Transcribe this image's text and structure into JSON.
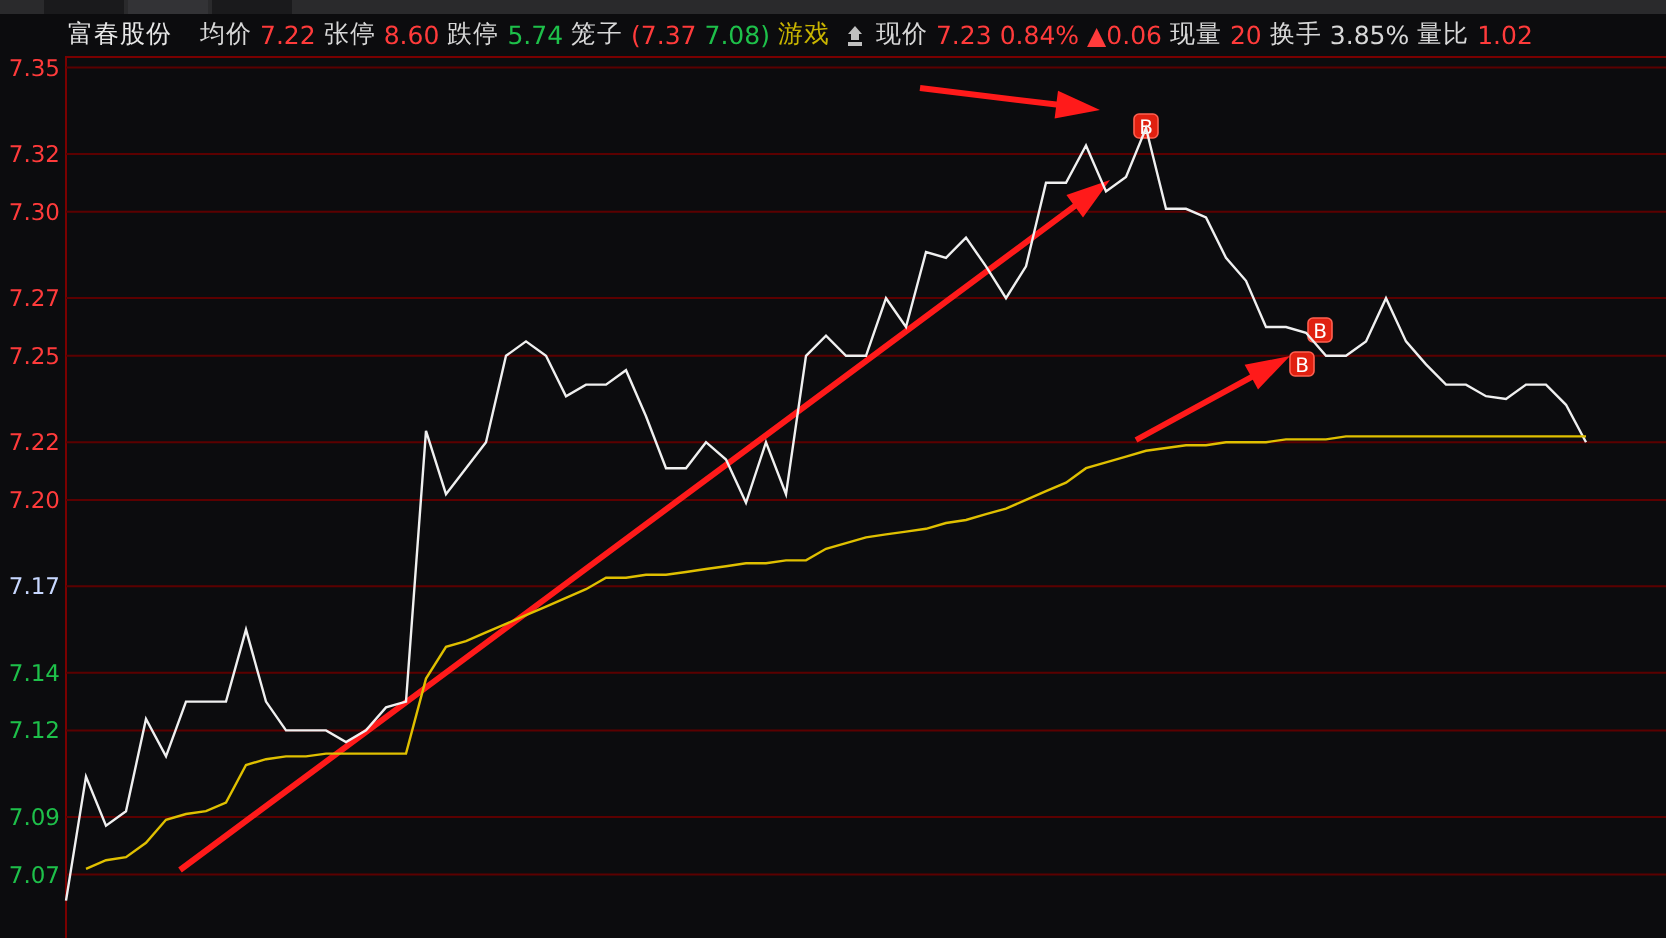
{
  "tabs": [
    {
      "selected": false
    },
    {
      "selected": true
    },
    {
      "selected": false
    }
  ],
  "header": {
    "stock_name": "富春股份",
    "items": [
      {
        "text": "均价",
        "color": "#d8d8d8"
      },
      {
        "text": "7.22",
        "color": "#ff3b3b"
      },
      {
        "text": "张停",
        "color": "#d8d8d8"
      },
      {
        "text": "8.60",
        "color": "#ff3b3b"
      },
      {
        "text": "跌停",
        "color": "#d8d8d8"
      },
      {
        "text": "5.74",
        "color": "#1ec04a"
      },
      {
        "text": "笼子",
        "color": "#d8d8d8"
      },
      {
        "text": "(7.37",
        "color": "#ff3b3b"
      },
      {
        "text": "7.08)",
        "color": "#1ec04a"
      },
      {
        "text": "游戏",
        "color": "#c8b400"
      },
      {
        "kind": "icon"
      },
      {
        "text": "现价",
        "color": "#d8d8d8"
      },
      {
        "text": "7.23",
        "color": "#ff3b3b"
      },
      {
        "text": "0.84%",
        "color": "#ff3b3b"
      },
      {
        "text": "▲0.06",
        "color": "#ff3b3b"
      },
      {
        "text": "现量",
        "color": "#d8d8d8"
      },
      {
        "text": "20",
        "color": "#ff3b3b"
      },
      {
        "text": "换手",
        "color": "#d8d8d8"
      },
      {
        "text": "3.85%",
        "color": "#d8d8d8"
      },
      {
        "text": "量比",
        "color": "#d8d8d8"
      },
      {
        "text": "1.02",
        "color": "#ff3b3b"
      }
    ]
  },
  "axis_label_colors": [
    {
      "color": "#ff3b3b"
    },
    {
      "color": "#ff3b3b"
    },
    {
      "color": "#ff3b3b"
    },
    {
      "color": "#ff3b3b"
    },
    {
      "color": "#ff3b3b"
    },
    {
      "color": "#ff3b3b"
    },
    {
      "color": "#ff3b3b"
    },
    {
      "color": "#c8d8ff"
    },
    {
      "color": "#1ec04a"
    },
    {
      "color": "#1ec04a"
    },
    {
      "color": "#1ec04a"
    },
    {
      "color": "#1ec04a"
    }
  ],
  "trade_marks": [
    {
      "label": "B"
    },
    {
      "label": "B"
    },
    {
      "label": "B"
    }
  ],
  "chart_data": {
    "type": "line",
    "ylim": [
      7.048,
      7.354
    ],
    "categories": [
      null,
      null,
      null,
      null,
      null,
      null,
      null,
      null,
      null,
      null,
      null,
      null,
      null,
      null,
      null,
      null,
      null,
      null,
      null,
      null,
      null,
      null,
      null,
      null,
      null,
      null,
      null,
      null,
      null,
      null,
      null,
      null,
      null,
      null,
      null,
      null,
      null,
      null,
      null,
      null,
      null,
      null,
      null,
      null,
      null,
      null,
      null,
      null,
      null,
      null,
      null,
      null,
      null,
      null,
      null,
      null,
      null,
      null,
      null,
      null,
      null,
      null,
      null,
      null,
      null,
      null,
      null,
      null,
      null,
      null,
      null,
      null,
      null,
      null,
      null,
      null,
      null
    ],
    "yticks": [
      {
        "value": 7.35,
        "label": "7.35"
      },
      {
        "value": 7.32,
        "label": "7.32"
      },
      {
        "value": 7.3,
        "label": "7.30"
      },
      {
        "value": 7.27,
        "label": "7.27"
      },
      {
        "value": 7.25,
        "label": "7.25"
      },
      {
        "value": 7.22,
        "label": "7.22"
      },
      {
        "value": 7.2,
        "label": "7.20"
      },
      {
        "value": 7.17,
        "label": "7.17"
      },
      {
        "value": 7.14,
        "label": "7.14"
      },
      {
        "value": 7.12,
        "label": "7.12"
      },
      {
        "value": 7.09,
        "label": "7.09"
      },
      {
        "value": 7.07,
        "label": "7.07"
      }
    ],
    "grid": true,
    "series": [
      {
        "color": "#f0f0f0",
        "values": [
          7.061,
          7.104,
          7.087,
          7.092,
          7.124,
          7.111,
          7.13,
          7.13,
          7.13,
          7.155,
          7.13,
          7.12,
          7.12,
          7.12,
          7.116,
          7.12,
          7.128,
          7.13,
          7.224,
          7.202,
          7.211,
          7.22,
          7.25,
          7.255,
          7.25,
          7.236,
          7.24,
          7.24,
          7.245,
          7.229,
          7.211,
          7.211,
          7.22,
          7.214,
          7.199,
          7.22,
          7.202,
          7.25,
          7.257,
          7.25,
          7.25,
          7.27,
          7.26,
          7.286,
          7.284,
          7.291,
          7.281,
          7.27,
          7.281,
          7.31,
          7.31,
          7.323,
          7.307,
          7.312,
          7.329,
          7.301,
          7.301,
          7.298,
          7.284,
          7.276,
          7.26,
          7.26,
          7.258,
          7.25,
          7.25,
          7.255,
          7.27,
          7.255,
          7.247,
          7.24,
          7.24,
          7.236,
          7.235,
          7.24,
          7.24,
          7.233,
          7.22
        ]
      },
      {
        "color": "#e0c000",
        "values": [
          null,
          7.072,
          7.075,
          7.076,
          7.081,
          7.089,
          7.091,
          7.092,
          7.095,
          7.108,
          7.11,
          7.111,
          7.111,
          7.112,
          7.112,
          7.112,
          7.112,
          7.112,
          7.138,
          7.149,
          7.151,
          7.154,
          7.157,
          7.16,
          7.163,
          7.166,
          7.169,
          7.173,
          7.173,
          7.174,
          7.174,
          7.175,
          7.176,
          7.177,
          7.178,
          7.178,
          7.179,
          7.179,
          7.183,
          7.185,
          7.187,
          7.188,
          7.189,
          7.19,
          7.192,
          7.193,
          7.195,
          7.197,
          7.2,
          7.203,
          7.206,
          7.211,
          7.213,
          7.215,
          7.217,
          7.218,
          7.219,
          7.219,
          7.22,
          7.22,
          7.22,
          7.221,
          7.221,
          7.221,
          7.222,
          7.222,
          7.222,
          7.222,
          7.222,
          7.222,
          7.222,
          7.222,
          7.222,
          7.222,
          7.222,
          7.222,
          7.222
        ]
      }
    ]
  }
}
